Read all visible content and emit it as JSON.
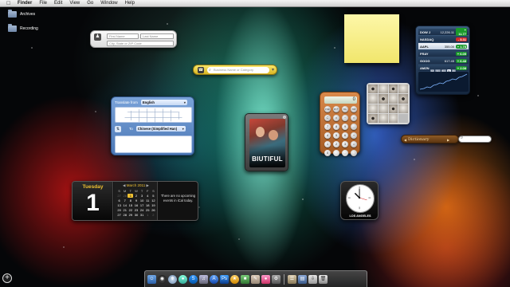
{
  "menubar": {
    "items": [
      "Finder",
      "File",
      "Edit",
      "View",
      "Go",
      "Window",
      "Help"
    ]
  },
  "desktop": {
    "icons": [
      {
        "label": "Archives",
        "icon": "folder-icon"
      },
      {
        "label": "Recording",
        "icon": "folder-icon"
      }
    ]
  },
  "address_book": {
    "first_name_placeholder": "First Name",
    "last_name_placeholder": "Last Name",
    "city_placeholder": "City, State or ZIP Code"
  },
  "business": {
    "placeholder": "Business Name or Category"
  },
  "translate": {
    "from_label": "Translate from",
    "from_value": "English",
    "to_label": "To",
    "to_value": "Chinese (Simplified Han)"
  },
  "movies": {
    "title": "BIUTIFUL"
  },
  "calculator": {
    "display": "0",
    "keys": [
      "mc",
      "m+",
      "m-",
      "mr",
      "C",
      "±",
      "÷",
      "×",
      "7",
      "8",
      "9",
      "-",
      "4",
      "5",
      "6",
      "+",
      "1",
      "2",
      "3",
      "=",
      "0",
      "",
      ".",
      ""
    ]
  },
  "stocks": {
    "rows": [
      {
        "symbol": "DOW J",
        "price": "12,226.11",
        "change": "+ 11.77",
        "direction": "up",
        "highlight": false
      },
      {
        "symbol": "NASDAQ",
        "price": "",
        "change": "- 5.31",
        "direction": "down",
        "highlight": false
      },
      {
        "symbol": "AAPL",
        "price": "355.00",
        "change": "+ 1.78",
        "direction": "up",
        "highlight": true
      },
      {
        "symbol": "FRAY",
        "price": "",
        "change": "+ 6.05",
        "direction": "up",
        "highlight": false
      },
      {
        "symbol": "GOOG",
        "price": "617.45",
        "change": "+ 6.48",
        "direction": "up",
        "highlight": false
      },
      {
        "symbol": "AMZN",
        "price": "",
        "change": "+ 2.08",
        "direction": "up",
        "highlight": false
      }
    ],
    "ranges": [
      "1d",
      "3m",
      "6m",
      "1y",
      "2y"
    ],
    "active_range": "1y",
    "colors": {
      "up": "#1a9a2b",
      "down": "#d12828"
    }
  },
  "dictionary": {
    "label": "Dictionary"
  },
  "calendar": {
    "day_name": "Tuesday",
    "date": "1",
    "month_title": "March 2011",
    "weekday_headers": [
      "S",
      "M",
      "T",
      "W",
      "T",
      "F",
      "S"
    ],
    "events_text": "There are no upcoming events in iCal today."
  },
  "clock": {
    "city": "LOS ANGELES"
  },
  "accent_colors": {
    "sticky": "#f7ee8a",
    "calendar_gold": "#f1c232"
  }
}
